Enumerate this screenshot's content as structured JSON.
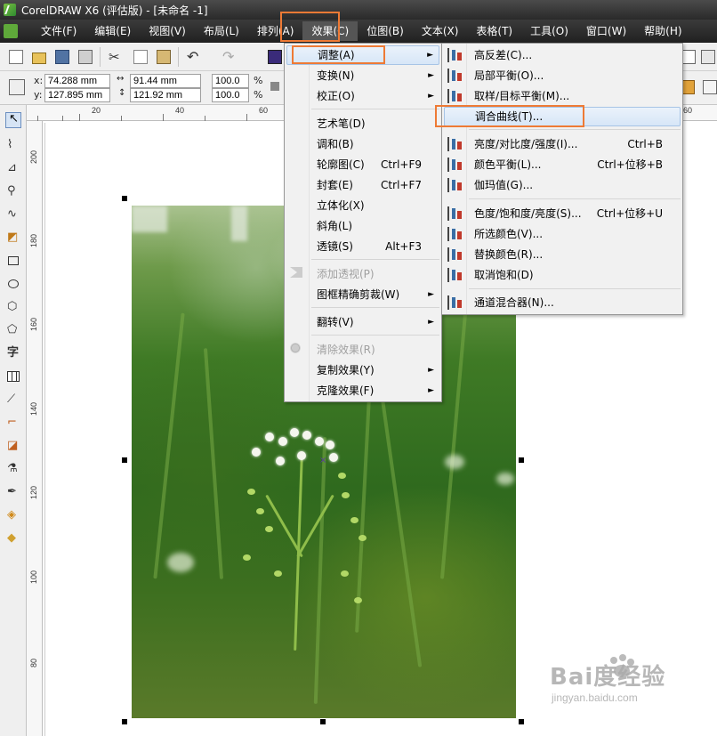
{
  "window": {
    "title": "CorelDRAW X6 (评估版) - [未命名 -1]"
  },
  "menubar": {
    "items": [
      {
        "label": "文件(F)"
      },
      {
        "label": "编辑(E)"
      },
      {
        "label": "视图(V)"
      },
      {
        "label": "布局(L)"
      },
      {
        "label": "排列(A)"
      },
      {
        "label": "效果(C)"
      },
      {
        "label": "位图(B)"
      },
      {
        "label": "文本(X)"
      },
      {
        "label": "表格(T)"
      },
      {
        "label": "工具(O)"
      },
      {
        "label": "窗口(W)"
      },
      {
        "label": "帮助(H)"
      }
    ]
  },
  "propertybar": {
    "x_label": "x:",
    "x_value": "74.288 mm",
    "y_label": "y:",
    "y_value": "127.895 mm",
    "w_value": "91.44 mm",
    "h_value": "121.92 mm",
    "scale_x": "100.0",
    "scale_y": "100.0",
    "pct1": "%",
    "pct2": "%"
  },
  "ruler": {
    "top": [
      "20",
      "40",
      "60",
      "160"
    ],
    "left": [
      "200",
      "180",
      "160",
      "140",
      "120",
      "100",
      "80"
    ]
  },
  "effects_menu": {
    "items": [
      {
        "label": "调整(A)",
        "arrow": "►"
      },
      {
        "label": "变换(N)",
        "arrow": "►"
      },
      {
        "label": "校正(O)",
        "arrow": "►"
      },
      {
        "label": "艺术笔(D)"
      },
      {
        "label": "调和(B)"
      },
      {
        "label": "轮廓图(C)",
        "shortcut": "Ctrl+F9"
      },
      {
        "label": "封套(E)",
        "shortcut": "Ctrl+F7"
      },
      {
        "label": "立体化(X)"
      },
      {
        "label": "斜角(L)"
      },
      {
        "label": "透镜(S)",
        "shortcut": "Alt+F3"
      },
      {
        "label": "添加透视(P)"
      },
      {
        "label": "图框精确剪裁(W)",
        "arrow": "►"
      },
      {
        "label": "翻转(V)",
        "arrow": "►"
      },
      {
        "label": "清除效果(R)"
      },
      {
        "label": "复制效果(Y)",
        "arrow": "►"
      },
      {
        "label": "克隆效果(F)",
        "arrow": "►"
      }
    ]
  },
  "adjust_submenu": {
    "items": [
      {
        "label": "高反差(C)..."
      },
      {
        "label": "局部平衡(O)..."
      },
      {
        "label": "取样/目标平衡(M)..."
      },
      {
        "label": "调合曲线(T)..."
      },
      {
        "label": "亮度/对比度/强度(I)...",
        "shortcut": "Ctrl+B"
      },
      {
        "label": "颜色平衡(L)...",
        "shortcut": "Ctrl+位移+B"
      },
      {
        "label": "伽玛值(G)..."
      },
      {
        "label": "色度/饱和度/亮度(S)...",
        "shortcut": "Ctrl+位移+U"
      },
      {
        "label": "所选颜色(V)..."
      },
      {
        "label": "替换颜色(R)..."
      },
      {
        "label": "取消饱和(D)"
      },
      {
        "label": "通道混合器(N)..."
      }
    ]
  },
  "toolbox": {
    "text_tool_glyph": "字"
  },
  "watermark": {
    "main": "Bai度经验",
    "sub": "jingyan.baidu.com"
  },
  "colors": {
    "highlight": "#ee7a35",
    "menubar_bg": "#2b2b2b",
    "menu_hover": "#d7e6f7"
  }
}
